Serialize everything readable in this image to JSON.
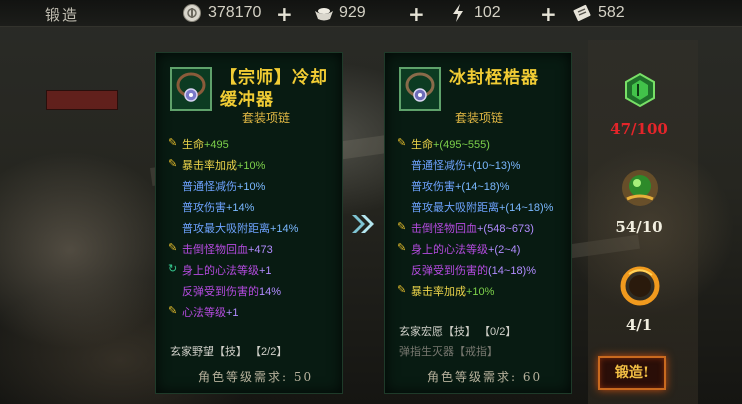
{
  "header": {
    "title": "锻造",
    "resources": [
      {
        "icon": "coin-icon",
        "value": "378170"
      },
      {
        "icon": "ingot-icon",
        "value": "929"
      },
      {
        "icon": "lightning-icon",
        "value": "102"
      },
      {
        "icon": "ticket-icon",
        "value": "582"
      }
    ],
    "plus": "+"
  },
  "current_item": {
    "title": "【宗师】冷却缓冲器",
    "subtitle": "套装项链",
    "stats": [
      {
        "k": "生命",
        "v": "+495"
      },
      {
        "k": "暴击率加成",
        "v": "+10%"
      },
      {
        "k": "普通怪减伤",
        "v": "+10%"
      },
      {
        "k": "普攻伤害",
        "v": "+14%"
      },
      {
        "k": "普攻最大吸附距离",
        "v": "+14%"
      },
      {
        "k": "击倒怪物回血",
        "v": "+473"
      },
      {
        "k": "身上的心法等级",
        "v": "+1"
      },
      {
        "k": "反弹受到伤害的",
        "v": "14%"
      },
      {
        "k": "心法等级",
        "v": "+1"
      }
    ],
    "skill": "玄家野望【技】 【2/2】",
    "requirement": "角色等级需求: 50"
  },
  "next_item": {
    "title": "冰封桎梏器",
    "subtitle": "套装项链",
    "stats": [
      {
        "k": "生命",
        "v": "+(495~555)"
      },
      {
        "k": "普通怪减伤",
        "v": "+(10~13)%"
      },
      {
        "k": "普攻伤害",
        "v": "+(14~18)%"
      },
      {
        "k": "普攻最大吸附距离",
        "v": "+(14~18)%"
      },
      {
        "k": "击倒怪物回血",
        "v": "+(548~673)"
      },
      {
        "k": "身上的心法等级",
        "v": "+(2~4)"
      },
      {
        "k": "反弹受到伤害的",
        "v": "(14~18)%"
      },
      {
        "k": "暴击率加成",
        "v": "+10%"
      }
    ],
    "skill": "玄家宏愿【技】 【0/2】",
    "skill2": "弹指生灭器【戒指】",
    "requirement": "角色等级需求: 60"
  },
  "materials": [
    {
      "icon": "green-gem-icon",
      "count": "47/100",
      "color": "#e4252a"
    },
    {
      "icon": "green-orb-icon",
      "count": "54/10",
      "color": "#f2efe0"
    },
    {
      "icon": "fire-ring-icon",
      "count": "4/1",
      "color": "#f2efe0"
    }
  ],
  "forge_button": "锻造!"
}
